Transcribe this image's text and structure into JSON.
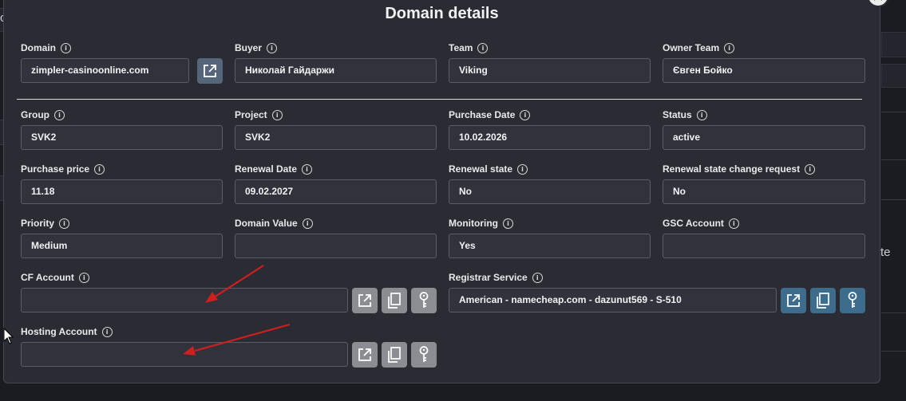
{
  "background": {
    "side_text_1": "c",
    "side_text_2": "te"
  },
  "modal": {
    "title": "Domain details",
    "fields": {
      "domain": {
        "label": "Domain",
        "value": "zimpler-casinoonline.com"
      },
      "buyer": {
        "label": "Buyer",
        "value": "Николай Гайдаржи"
      },
      "team": {
        "label": "Team",
        "value": "Viking"
      },
      "owner_team": {
        "label": "Owner Team",
        "value": "Євген Бойко"
      },
      "group": {
        "label": "Group",
        "value": "SVK2"
      },
      "project": {
        "label": "Project",
        "value": "SVK2"
      },
      "purchase_date": {
        "label": "Purchase Date",
        "value": "10.02.2026"
      },
      "status": {
        "label": "Status",
        "value": "active"
      },
      "purchase_price": {
        "label": "Purchase price",
        "value": "11.18"
      },
      "renewal_date": {
        "label": "Renewal Date",
        "value": "09.02.2027"
      },
      "renewal_state": {
        "label": "Renewal state",
        "value": "No"
      },
      "renewal_state_change_request": {
        "label": "Renewal state change request",
        "value": "No"
      },
      "priority": {
        "label": "Priority",
        "value": "Medium"
      },
      "domain_value": {
        "label": "Domain Value",
        "value": ""
      },
      "monitoring": {
        "label": "Monitoring",
        "value": "Yes"
      },
      "gsc_account": {
        "label": "GSC Account",
        "value": ""
      },
      "cf_account": {
        "label": "CF Account",
        "value": ""
      },
      "registrar_service": {
        "label": "Registrar Service",
        "value": "American - namecheap.com - dazunut569 - S-510"
      },
      "hosting_account": {
        "label": "Hosting Account",
        "value": ""
      }
    },
    "info_glyph": "i"
  },
  "colors": {
    "modal_bg": "#2a2b33",
    "input_bg": "#31323b",
    "button_grey": "#8c8d92",
    "button_blue": "#3d6c8d",
    "arrow_red": "#d11f1f"
  },
  "icons": [
    "external-link-icon",
    "copy-icon",
    "key-icon",
    "close-icon",
    "info-icon"
  ]
}
